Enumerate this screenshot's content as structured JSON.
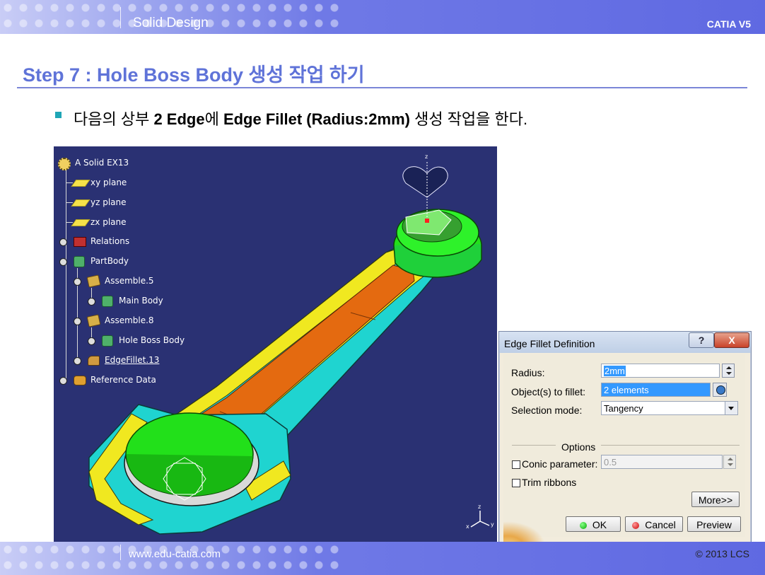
{
  "header": {
    "title": "Solid Design",
    "right_label": "CATIA V5"
  },
  "step": {
    "title": "Step 7 : Hole Boss Body 생성 작업 하기"
  },
  "bullet": {
    "t1": "다음의 상부 ",
    "t2": "2 Edge",
    "t3": "에 ",
    "t4": "Edge Fillet (Radius:2mm)",
    "t5": " 생성 작업을 한다."
  },
  "tree": {
    "root": "A Solid EX13",
    "xy": "xy plane",
    "yz": "yz plane",
    "zx": "zx plane",
    "relations": "Relations",
    "partbody": "PartBody",
    "assemble5": "Assemble.5",
    "mainbody": "Main Body",
    "assemble8": "Assemble.8",
    "holeboss": "Hole Boss Body",
    "fillet": "EdgeFillet.13",
    "refdata": "Reference Data"
  },
  "compass": {
    "z": "z",
    "x": "x",
    "y": "y"
  },
  "dialog": {
    "title": "Edge Fillet Definition",
    "help": "?",
    "close": "X",
    "radius_label": "Radius:",
    "radius_value": "2mm",
    "objects_label": "Object(s) to fillet:",
    "objects_value": "2 elements",
    "mode_label": "Selection mode:",
    "mode_value": "Tangency",
    "options_label": "Options",
    "conic_label": "Conic parameter:",
    "conic_value": "0.5",
    "trim_label": "Trim ribbons",
    "more_btn": "More>>",
    "ok_btn": "OK",
    "cancel_btn": "Cancel",
    "preview_btn": "Preview"
  },
  "footer": {
    "url": "www.edu-catia.com",
    "copyright": "© 2013 LCS"
  },
  "colors": {
    "band_accent": "#5f69e2",
    "title_blue": "#5f73d8",
    "viewport_bg": "#2a3173",
    "boss_green": "#22e01a",
    "arm_orange": "#e46a10",
    "rim_cyan": "#1fd4d0",
    "edge_yellow": "#f0e820"
  },
  "icons": [
    "plane-icon",
    "gear-icon",
    "relations-icon",
    "partbody-icon",
    "assemble-icon",
    "body-icon",
    "fillet-icon",
    "reference-icon",
    "help-icon",
    "close-icon",
    "pick-icon"
  ]
}
